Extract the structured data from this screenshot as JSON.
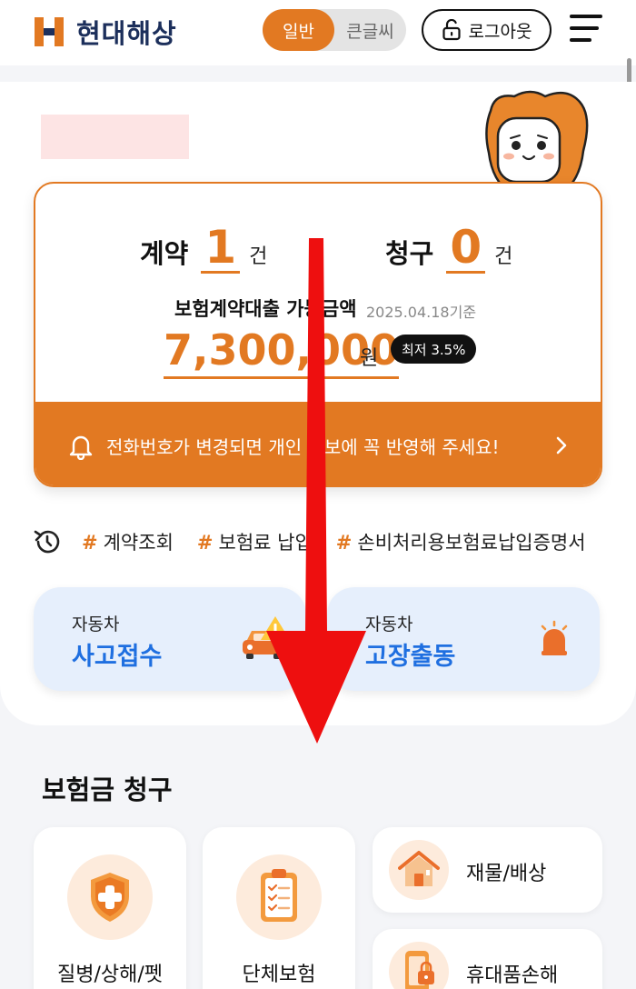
{
  "header": {
    "brand": "현대해상",
    "font_size_toggle": {
      "options": [
        "일반",
        "큰글씨"
      ],
      "selected": "일반"
    },
    "logout_label": "로그아웃"
  },
  "summary": {
    "contract_label": "계약",
    "contract_count": "1",
    "claim_label": "청구",
    "claim_count": "0",
    "count_unit": "건",
    "loan_label": "보험계약대출 가능금액",
    "loan_date": "2025.04.18기준",
    "loan_amount": "7,300,000",
    "loan_unit": "원",
    "loan_rate": "최저 3.5%",
    "notice": "전화번호가 변경되면 개인 정보에 꼭 반영해 주세요!"
  },
  "quick_tags": [
    "계약조회",
    "보험료 납입",
    "손비처리용보험료납입증명서"
  ],
  "quick_tag_hash": "#",
  "car_services": [
    {
      "sub": "자동차",
      "main": "사고접수"
    },
    {
      "sub": "자동차",
      "main": "고장출동"
    }
  ],
  "claims": {
    "title": "보험금 청구",
    "tiles": [
      {
        "label": "질병/상해/펫",
        "icon": "medical-shield-icon"
      },
      {
        "label": "단체보험",
        "icon": "clipboard-icon"
      }
    ],
    "rows": [
      {
        "label": "재물/배상",
        "icon": "house-icon"
      },
      {
        "label": "휴대품손해",
        "icon": "phone-lock-icon"
      }
    ]
  },
  "colors": {
    "accent": "#e27922",
    "brand_navy": "#1c2f5b",
    "service_blue": "#1f6fe0",
    "overlay_arrow": "#ee0f0f"
  }
}
